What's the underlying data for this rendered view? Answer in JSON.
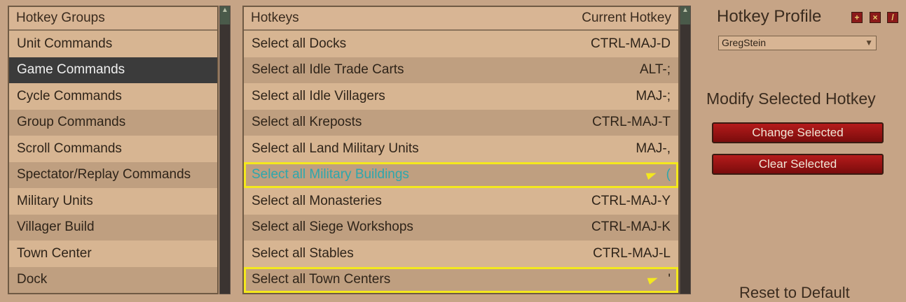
{
  "groups": {
    "header": "Hotkey Groups",
    "items": [
      {
        "label": "Unit Commands"
      },
      {
        "label": "Game Commands",
        "selected": true
      },
      {
        "label": "Cycle Commands"
      },
      {
        "label": "Group Commands"
      },
      {
        "label": "Scroll Commands"
      },
      {
        "label": "Spectator/Replay Commands"
      },
      {
        "label": "Military Units"
      },
      {
        "label": "Villager Build"
      },
      {
        "label": "Town Center"
      },
      {
        "label": "Dock"
      }
    ]
  },
  "hotkeys": {
    "header_name": "Hotkeys",
    "header_key": "Current Hotkey",
    "rows": [
      {
        "label": "Select all Docks",
        "key": "CTRL-MAJ-D"
      },
      {
        "label": "Select all Idle Trade Carts",
        "key": "ALT-;"
      },
      {
        "label": "Select all Idle Villagers",
        "key": "MAJ-;"
      },
      {
        "label": "Select all Kreposts",
        "key": "CTRL-MAJ-T"
      },
      {
        "label": "Select all Land Military Units",
        "key": "MAJ-,"
      },
      {
        "label": "Select all Military Buildings",
        "key": "(",
        "conflict": true,
        "highlight": true
      },
      {
        "label": "Select all Monasteries",
        "key": "CTRL-MAJ-Y"
      },
      {
        "label": "Select all Siege Workshops",
        "key": "CTRL-MAJ-K"
      },
      {
        "label": "Select all Stables",
        "key": "CTRL-MAJ-L"
      },
      {
        "label": "Select all Town Centers",
        "key": "'",
        "conflict": true
      }
    ]
  },
  "profile": {
    "title": "Hotkey Profile",
    "selected": "GregStein",
    "icons": [
      "add-icon",
      "delete-icon",
      "edit-icon"
    ]
  },
  "modify": {
    "title": "Modify Selected Hotkey",
    "change_label": "Change Selected",
    "clear_label": "Clear Selected"
  },
  "reset_label": "Reset to Default",
  "colors": {
    "conflict_outline": "#f4e81d",
    "highlight_text": "#2da7ad",
    "button_red": "#9a1414"
  }
}
